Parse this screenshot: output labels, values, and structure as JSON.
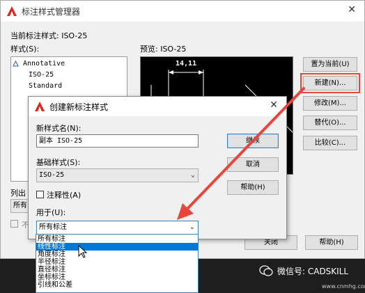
{
  "bg_dialog": {
    "title": "标注样式管理器",
    "close_glyph": "✕",
    "current_style_label": "当前标注样式: ISO-25",
    "styles_label": "样式(S):",
    "styles": [
      "Annotative",
      "ISO-25",
      "Standard"
    ],
    "preview_label": "预览: ISO-25",
    "preview_dimension": "14,11",
    "list_label": "列出",
    "list_value": "所有",
    "checkbox_label": "不",
    "buttons": {
      "set_current": "置为当前(U)",
      "new": "新建(N)...",
      "modify": "修改(M)...",
      "override": "替代(O)...",
      "compare": "比较(C)...",
      "close": "关闭",
      "help": "帮助(H)"
    }
  },
  "dialog": {
    "title": "创建新标注样式",
    "close_glyph": "✕",
    "new_name_label": "新样式名(N):",
    "new_name_value": "副本 ISO-25",
    "base_style_label": "基础样式(S):",
    "base_style_value": "ISO-25",
    "annotative_label": "注释性(A)",
    "use_for_label": "用于(U):",
    "use_for_value": "所有标注",
    "buttons": {
      "continue": "继续",
      "cancel": "取消",
      "help": "帮助(H)"
    }
  },
  "dropdown": {
    "items": [
      "所有标注",
      "线性标注",
      "角度标注",
      "半径标注",
      "直径标注",
      "坐标标注",
      "引线和公差"
    ],
    "selected_index": 1
  },
  "watermark": {
    "text": "微信号: CADSKILL",
    "url": "www.cnmhg.com"
  },
  "colors": {
    "arrow": "#e8463c",
    "highlight_box": "#e8463c",
    "selection": "#0078d7"
  }
}
